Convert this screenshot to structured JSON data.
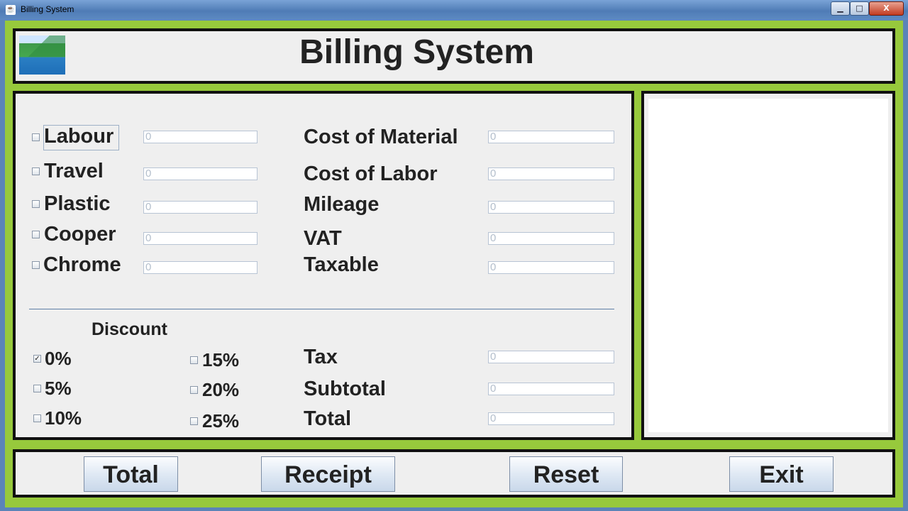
{
  "window": {
    "title": "Billing System",
    "min": "▁",
    "max": "□",
    "close": "X"
  },
  "header": {
    "title": "Billing System"
  },
  "items": [
    {
      "label": "Labour",
      "value": "0",
      "checked": false
    },
    {
      "label": "Travel",
      "value": "0",
      "checked": false
    },
    {
      "label": "Plastic",
      "value": "0",
      "checked": false
    },
    {
      "label": "Cooper",
      "value": "0",
      "checked": false
    },
    {
      "label": "Chrome",
      "value": "0",
      "checked": false
    }
  ],
  "costs": [
    {
      "label": "Cost of Material",
      "value": "0"
    },
    {
      "label": "Cost of Labor",
      "value": "0"
    },
    {
      "label": "Mileage",
      "value": "0"
    },
    {
      "label": "VAT",
      "value": "0"
    },
    {
      "label": "Taxable",
      "value": "0"
    }
  ],
  "discount": {
    "title": "Discount",
    "options": [
      {
        "label": "0%",
        "checked": true
      },
      {
        "label": "5%",
        "checked": false
      },
      {
        "label": "10%",
        "checked": false
      },
      {
        "label": "15%",
        "checked": false
      },
      {
        "label": "20%",
        "checked": false
      },
      {
        "label": "25%",
        "checked": false
      }
    ]
  },
  "totals": [
    {
      "label": "Tax",
      "value": "0"
    },
    {
      "label": "Subtotal",
      "value": "0"
    },
    {
      "label": "Total",
      "value": "0"
    }
  ],
  "buttons": {
    "total": "Total",
    "receipt": "Receipt",
    "reset": "Reset",
    "exit": "Exit"
  },
  "colors": {
    "frame": "#97c93c",
    "panel": "#efefef",
    "border": "#111111"
  }
}
